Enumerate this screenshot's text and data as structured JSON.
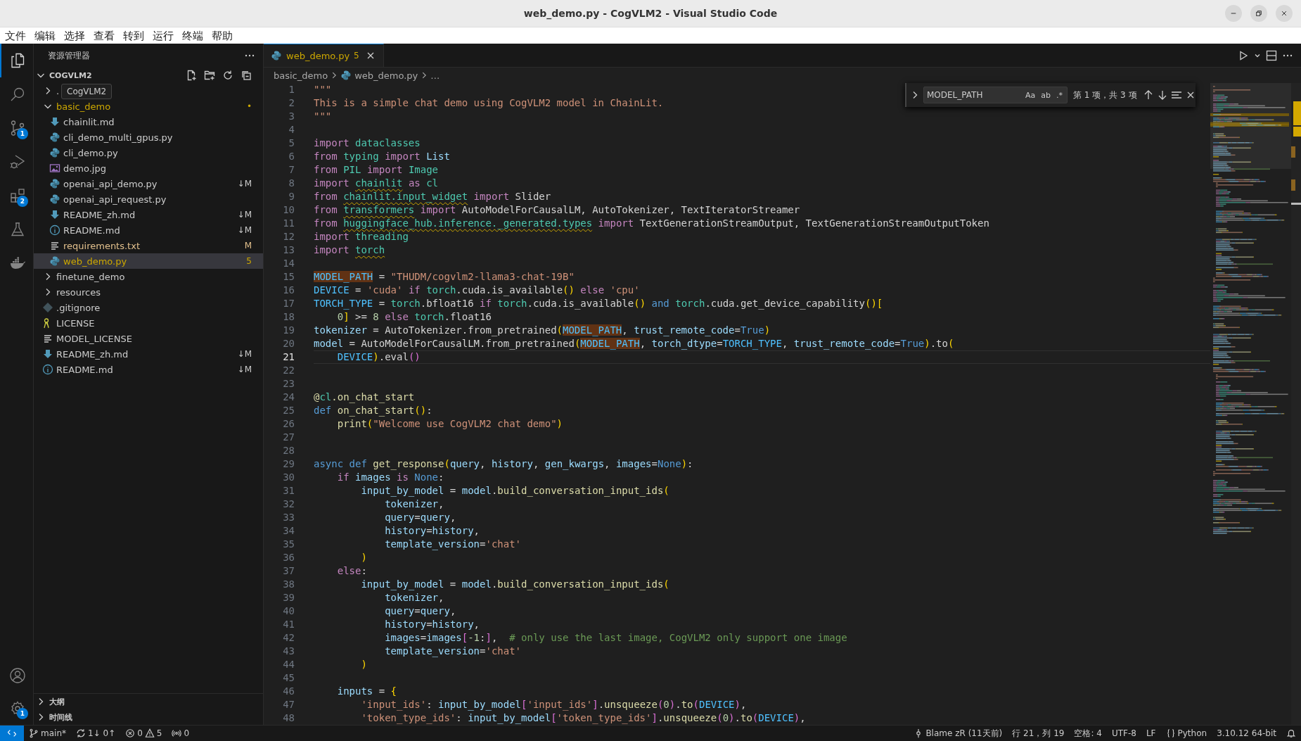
{
  "window": {
    "title": "web_demo.py - CogVLM2 - Visual Studio Code",
    "controls": [
      {
        "kind": "minimize"
      },
      {
        "kind": "maximize"
      },
      {
        "kind": "close"
      }
    ]
  },
  "menu": [
    "文件",
    "编辑",
    "选择",
    "查看",
    "转到",
    "运行",
    "终端",
    "帮助"
  ],
  "activity_bar": {
    "top": [
      {
        "kind": "explorer",
        "selected": true
      },
      {
        "kind": "search",
        "selected": false
      },
      {
        "kind": "source-control",
        "selected": false,
        "badge": "1"
      },
      {
        "kind": "run-debug",
        "selected": false
      },
      {
        "kind": "extensions",
        "selected": false,
        "badge": "2"
      },
      {
        "kind": "testing",
        "selected": false
      },
      {
        "kind": "docker",
        "selected": false
      }
    ],
    "bottom": [
      {
        "kind": "account",
        "selected": false
      },
      {
        "kind": "settings",
        "selected": false,
        "badge": "1"
      }
    ]
  },
  "explorer": {
    "title": "资源管理器",
    "tooltip": "CogVLM2",
    "root": {
      "label": "COGVLM2",
      "expanded": true,
      "children": [
        {
          "label": ".",
          "kind": "folder",
          "expanded": false,
          "selected": false
        },
        {
          "label": "basic_demo",
          "kind": "folder",
          "expanded": true,
          "selected": false,
          "color": "#cca700",
          "badge": "•",
          "children": [
            {
              "label": "chainlit.md",
              "kind": "markdown",
              "selected": false,
              "color": "#cccccc"
            },
            {
              "label": "cli_demo_multi_gpus.py",
              "kind": "python",
              "selected": false,
              "color": "#cccccc"
            },
            {
              "label": "cli_demo.py",
              "kind": "python",
              "selected": false,
              "color": "#cccccc"
            },
            {
              "label": "demo.jpg",
              "kind": "image",
              "selected": false,
              "color": "#cccccc"
            },
            {
              "label": "openai_api_demo.py",
              "kind": "python",
              "selected": false,
              "color": "#cccccc",
              "badge": "↓M"
            },
            {
              "label": "openai_api_request.py",
              "kind": "python",
              "selected": false,
              "color": "#cccccc"
            },
            {
              "label": "README_zh.md",
              "kind": "markdown",
              "selected": false,
              "color": "#cccccc",
              "badge": "↓M"
            },
            {
              "label": "README.md",
              "kind": "info",
              "selected": false,
              "color": "#cccccc",
              "badge": "↓M"
            },
            {
              "label": "requirements.txt",
              "kind": "text",
              "selected": false,
              "color": "#e2c08d",
              "badge": "M"
            },
            {
              "label": "web_demo.py",
              "kind": "python",
              "selected": true,
              "color": "#cca700",
              "badge": "5"
            }
          ]
        },
        {
          "label": "finetune_demo",
          "kind": "folder",
          "expanded": false,
          "selected": false,
          "color": "#cccccc"
        },
        {
          "label": "resources",
          "kind": "folder",
          "expanded": false,
          "selected": false,
          "color": "#cccccc"
        },
        {
          "label": ".gitignore",
          "kind": "git",
          "selected": false,
          "color": "#cccccc"
        },
        {
          "label": "LICENSE",
          "kind": "license",
          "selected": false,
          "color": "#cccccc"
        },
        {
          "label": "MODEL_LICENSE",
          "kind": "text",
          "selected": false,
          "color": "#cccccc"
        },
        {
          "label": "README_zh.md",
          "kind": "markdown",
          "selected": false,
          "color": "#cccccc",
          "badge": "↓M"
        },
        {
          "label": "README.md",
          "kind": "info",
          "selected": false,
          "color": "#cccccc",
          "badge": "↓M"
        }
      ]
    },
    "sections": [
      {
        "label": "大纲",
        "expanded": false
      },
      {
        "label": "时间线",
        "expanded": false
      }
    ]
  },
  "editor": {
    "tabs": [
      {
        "label": "web_demo.py",
        "kind": "python",
        "badge": "5",
        "selected": true
      }
    ],
    "actions": [
      {
        "kind": "run"
      },
      {
        "kind": "caret"
      },
      {
        "kind": "split"
      },
      {
        "kind": "more"
      }
    ],
    "breadcrumb": [
      {
        "label": "basic_demo",
        "kind": "folder"
      },
      {
        "label": "web_demo.py",
        "kind": "python"
      },
      {
        "label": "…",
        "kind": "plain"
      }
    ],
    "find": {
      "value": "MODEL_PATH",
      "options": [
        "Aa",
        "ab",
        ".*"
      ],
      "result": "第 1 项，共 3 项"
    },
    "lines": [
      {
        "n": "1",
        "current": false,
        "tokens": [
          {
            "text": "\"\"\"",
            "kind": "str"
          }
        ]
      },
      {
        "n": "2",
        "current": false,
        "tokens": [
          {
            "text": "This is a simple chat demo using CogVLM2 model in ChainLit.",
            "kind": "str"
          }
        ]
      },
      {
        "n": "3",
        "current": false,
        "tokens": [
          {
            "text": "\"\"\"",
            "kind": "str"
          }
        ]
      },
      {
        "n": "4",
        "current": false
      },
      {
        "n": "5",
        "current": false,
        "tokens": [
          {
            "text": "import ",
            "kind": "kw"
          },
          {
            "text": "dataclasses",
            "kind": "mod"
          }
        ]
      },
      {
        "n": "6",
        "current": false,
        "tokens": [
          {
            "text": "from ",
            "kind": "kw"
          },
          {
            "text": "typing ",
            "kind": "mod"
          },
          {
            "text": "import ",
            "kind": "kw"
          },
          {
            "text": "List",
            "kind": "var"
          }
        ]
      },
      {
        "n": "7",
        "current": false,
        "tokens": [
          {
            "text": "from ",
            "kind": "kw"
          },
          {
            "text": "PIL ",
            "kind": "mod"
          },
          {
            "text": "import ",
            "kind": "kw"
          },
          {
            "text": "Image",
            "kind": "mod"
          }
        ]
      },
      {
        "n": "8",
        "current": false,
        "tokens": [
          {
            "text": "import ",
            "kind": "kw"
          },
          {
            "text": "chainlit",
            "kind": "mod",
            "warn": true
          },
          {
            "text": " as ",
            "kind": "kw"
          },
          {
            "text": "cl",
            "kind": "mod"
          }
        ]
      },
      {
        "n": "9",
        "current": false,
        "tokens": [
          {
            "text": "from ",
            "kind": "kw"
          },
          {
            "text": "chainlit.input_widget",
            "kind": "mod",
            "warn": true
          },
          {
            "text": " import",
            "kind": "kw"
          },
          {
            "text": " Slider",
            "kind": "p"
          }
        ]
      },
      {
        "n": "10",
        "current": false,
        "tokens": [
          {
            "text": "from ",
            "kind": "kw"
          },
          {
            "text": "transformers",
            "kind": "mod",
            "warn": true
          },
          {
            "text": " import",
            "kind": "kw"
          },
          {
            "text": " AutoModelForCausalLM, AutoTokenizer, TextIteratorStreamer",
            "kind": "p"
          }
        ]
      },
      {
        "n": "11",
        "current": false,
        "tokens": [
          {
            "text": "from ",
            "kind": "kw"
          },
          {
            "text": "huggingface_hub.inference._generated.types",
            "kind": "mod",
            "warn": true
          },
          {
            "text": " import",
            "kind": "kw"
          },
          {
            "text": " TextGenerationStreamOutput, TextGenerationStreamOutputToken",
            "kind": "p"
          }
        ]
      },
      {
        "n": "12",
        "current": false,
        "tokens": [
          {
            "text": "import ",
            "kind": "kw"
          },
          {
            "text": "threading",
            "kind": "mod"
          }
        ]
      },
      {
        "n": "13",
        "current": false,
        "tokens": [
          {
            "text": "import ",
            "kind": "kw"
          },
          {
            "text": "torch",
            "kind": "mod",
            "warn": true
          }
        ]
      },
      {
        "n": "14",
        "current": false
      },
      {
        "n": "15",
        "current": false,
        "tokens": [
          {
            "text": "MODEL_PATH",
            "kind": "const",
            "match": true
          },
          {
            "text": " = ",
            "kind": "p"
          },
          {
            "text": "\"THUDM/cogvlm2-llama3-chat-19B\"",
            "kind": "str"
          }
        ]
      },
      {
        "n": "16",
        "current": false,
        "tokens": [
          {
            "text": "DEVICE",
            "kind": "const"
          },
          {
            "text": " = ",
            "kind": "p"
          },
          {
            "text": "'cuda' ",
            "kind": "str"
          },
          {
            "text": "if ",
            "kind": "kw"
          },
          {
            "text": "torch",
            "kind": "mod"
          },
          {
            "text": ".cuda.is_available",
            "kind": "p"
          },
          {
            "text": "()",
            "kind": "br"
          },
          {
            "text": " else ",
            "kind": "kw"
          },
          {
            "text": "'cpu'",
            "kind": "str"
          }
        ]
      },
      {
        "n": "17",
        "current": false,
        "tokens": [
          {
            "text": "TORCH_TYPE",
            "kind": "const"
          },
          {
            "text": " = ",
            "kind": "p"
          },
          {
            "text": "torch",
            "kind": "mod"
          },
          {
            "text": ".bfloat16 ",
            "kind": "p"
          },
          {
            "text": "if ",
            "kind": "kw"
          },
          {
            "text": "torch",
            "kind": "mod"
          },
          {
            "text": ".cuda.is_available",
            "kind": "p"
          },
          {
            "text": "()",
            "kind": "br"
          },
          {
            "text": " and ",
            "kind": "def"
          },
          {
            "text": "torch",
            "kind": "mod"
          },
          {
            "text": ".cuda.get_device_capability",
            "kind": "p"
          },
          {
            "text": "()[",
            "kind": "br"
          }
        ]
      },
      {
        "n": "18",
        "current": false,
        "tokens": [
          {
            "text": "    0",
            "kind": "num"
          },
          {
            "text": "]",
            "kind": "br"
          },
          {
            "text": " >= ",
            "kind": "p"
          },
          {
            "text": "8 ",
            "kind": "num"
          },
          {
            "text": "else ",
            "kind": "kw"
          },
          {
            "text": "torch",
            "kind": "mod"
          },
          {
            "text": ".float16",
            "kind": "p"
          }
        ]
      },
      {
        "n": "19",
        "current": false,
        "tokens": [
          {
            "text": "tokenizer",
            "kind": "var"
          },
          {
            "text": " = AutoTokenizer.from_pretrained",
            "kind": "p"
          },
          {
            "text": "(",
            "kind": "br"
          },
          {
            "text": "MODEL_PATH",
            "kind": "const",
            "match": true
          },
          {
            "text": ", ",
            "kind": "p"
          },
          {
            "text": "trust_remote_code",
            "kind": "var"
          },
          {
            "text": "=",
            "kind": "p"
          },
          {
            "text": "True",
            "kind": "def"
          },
          {
            "text": ")",
            "kind": "br"
          }
        ]
      },
      {
        "n": "20",
        "current": false,
        "tokens": [
          {
            "text": "model",
            "kind": "var"
          },
          {
            "text": " = AutoModelForCausalLM.from_pretrained",
            "kind": "p"
          },
          {
            "text": "(",
            "kind": "br"
          },
          {
            "text": "MODEL_PATH",
            "kind": "const",
            "match": true
          },
          {
            "text": ", ",
            "kind": "p"
          },
          {
            "text": "torch_dtype",
            "kind": "var"
          },
          {
            "text": "=",
            "kind": "p"
          },
          {
            "text": "TORCH_TYPE",
            "kind": "const"
          },
          {
            "text": ", ",
            "kind": "p"
          },
          {
            "text": "trust_remote_code",
            "kind": "var"
          },
          {
            "text": "=",
            "kind": "p"
          },
          {
            "text": "True",
            "kind": "def"
          },
          {
            "text": ")",
            "kind": "br"
          },
          {
            "text": ".to",
            "kind": "p"
          },
          {
            "text": "(",
            "kind": "br"
          }
        ]
      },
      {
        "n": "21",
        "current": true,
        "tokens": [
          {
            "text": "    DEVICE",
            "kind": "const"
          },
          {
            "text": ")",
            "kind": "br"
          },
          {
            "text": ".eval",
            "kind": "p"
          },
          {
            "text": "()",
            "kind": "br2"
          }
        ]
      },
      {
        "n": "22",
        "current": false
      },
      {
        "n": "23",
        "current": false
      },
      {
        "n": "24",
        "current": false,
        "tokens": [
          {
            "text": "@",
            "kind": "fn"
          },
          {
            "text": "cl",
            "kind": "mod"
          },
          {
            "text": ".on_chat_start",
            "kind": "fn"
          }
        ]
      },
      {
        "n": "25",
        "current": false,
        "tokens": [
          {
            "text": "def ",
            "kind": "def"
          },
          {
            "text": "on_chat_start",
            "kind": "fn"
          },
          {
            "text": "()",
            "kind": "br"
          },
          {
            "text": ":",
            "kind": "p"
          }
        ]
      },
      {
        "n": "26",
        "current": false,
        "tokens": [
          {
            "text": "    print",
            "kind": "fn"
          },
          {
            "text": "(",
            "kind": "br"
          },
          {
            "text": "\"Welcome use CogVLM2 chat demo\"",
            "kind": "str"
          },
          {
            "text": ")",
            "kind": "br"
          }
        ]
      },
      {
        "n": "27",
        "current": false
      },
      {
        "n": "28",
        "current": false
      },
      {
        "n": "29",
        "current": false,
        "tokens": [
          {
            "text": "async def ",
            "kind": "def"
          },
          {
            "text": "get_response",
            "kind": "fn"
          },
          {
            "text": "(",
            "kind": "br"
          },
          {
            "text": "query",
            "kind": "var"
          },
          {
            "text": ", ",
            "kind": "p"
          },
          {
            "text": "history",
            "kind": "var"
          },
          {
            "text": ", ",
            "kind": "p"
          },
          {
            "text": "gen_kwargs",
            "kind": "var"
          },
          {
            "text": ", ",
            "kind": "p"
          },
          {
            "text": "images",
            "kind": "var"
          },
          {
            "text": "=",
            "kind": "p"
          },
          {
            "text": "None",
            "kind": "def"
          },
          {
            "text": ")",
            "kind": "br"
          },
          {
            "text": ":",
            "kind": "p"
          }
        ]
      },
      {
        "n": "30",
        "current": false,
        "tokens": [
          {
            "text": "    if ",
            "kind": "kw"
          },
          {
            "text": "images ",
            "kind": "var"
          },
          {
            "text": "is ",
            "kind": "kw"
          },
          {
            "text": "None",
            "kind": "def"
          },
          {
            "text": ":",
            "kind": "p"
          }
        ]
      },
      {
        "n": "31",
        "current": false,
        "tokens": [
          {
            "text": "        input_by_model",
            "kind": "var"
          },
          {
            "text": " = ",
            "kind": "p"
          },
          {
            "text": "model",
            "kind": "var"
          },
          {
            "text": ".",
            "kind": "p"
          },
          {
            "text": "build_conversation_input_ids",
            "kind": "fn"
          },
          {
            "text": "(",
            "kind": "br"
          }
        ]
      },
      {
        "n": "32",
        "current": false,
        "tokens": [
          {
            "text": "            tokenizer",
            "kind": "var"
          },
          {
            "text": ",",
            "kind": "p"
          }
        ]
      },
      {
        "n": "33",
        "current": false,
        "tokens": [
          {
            "text": "            query",
            "kind": "var"
          },
          {
            "text": "=",
            "kind": "p"
          },
          {
            "text": "query",
            "kind": "var"
          },
          {
            "text": ",",
            "kind": "p"
          }
        ]
      },
      {
        "n": "34",
        "current": false,
        "tokens": [
          {
            "text": "            history",
            "kind": "var"
          },
          {
            "text": "=",
            "kind": "p"
          },
          {
            "text": "history",
            "kind": "var"
          },
          {
            "text": ",",
            "kind": "p"
          }
        ]
      },
      {
        "n": "35",
        "current": false,
        "tokens": [
          {
            "text": "            template_version",
            "kind": "var"
          },
          {
            "text": "=",
            "kind": "p"
          },
          {
            "text": "'chat'",
            "kind": "str"
          }
        ]
      },
      {
        "n": "36",
        "current": false,
        "tokens": [
          {
            "text": "        )",
            "kind": "br"
          }
        ]
      },
      {
        "n": "37",
        "current": false,
        "tokens": [
          {
            "text": "    else",
            "kind": "kw"
          },
          {
            "text": ":",
            "kind": "p"
          }
        ]
      },
      {
        "n": "38",
        "current": false,
        "tokens": [
          {
            "text": "        input_by_model",
            "kind": "var"
          },
          {
            "text": " = ",
            "kind": "p"
          },
          {
            "text": "model",
            "kind": "var"
          },
          {
            "text": ".",
            "kind": "p"
          },
          {
            "text": "build_conversation_input_ids",
            "kind": "fn"
          },
          {
            "text": "(",
            "kind": "br"
          }
        ]
      },
      {
        "n": "39",
        "current": false,
        "tokens": [
          {
            "text": "            tokenizer",
            "kind": "var"
          },
          {
            "text": ",",
            "kind": "p"
          }
        ]
      },
      {
        "n": "40",
        "current": false,
        "tokens": [
          {
            "text": "            query",
            "kind": "var"
          },
          {
            "text": "=",
            "kind": "p"
          },
          {
            "text": "query",
            "kind": "var"
          },
          {
            "text": ",",
            "kind": "p"
          }
        ]
      },
      {
        "n": "41",
        "current": false,
        "tokens": [
          {
            "text": "            history",
            "kind": "var"
          },
          {
            "text": "=",
            "kind": "p"
          },
          {
            "text": "history",
            "kind": "var"
          },
          {
            "text": ",",
            "kind": "p"
          }
        ]
      },
      {
        "n": "42",
        "current": false,
        "tokens": [
          {
            "text": "            images",
            "kind": "var"
          },
          {
            "text": "=",
            "kind": "p"
          },
          {
            "text": "images",
            "kind": "var"
          },
          {
            "text": "[",
            "kind": "br2"
          },
          {
            "text": "-1",
            "kind": "num"
          },
          {
            "text": ":",
            "kind": "p"
          },
          {
            "text": "]",
            "kind": "br2"
          },
          {
            "text": ",  ",
            "kind": "p"
          },
          {
            "text": "# only use the last image, CogVLM2 only support one image",
            "kind": "cmt"
          }
        ]
      },
      {
        "n": "43",
        "current": false,
        "tokens": [
          {
            "text": "            template_version",
            "kind": "var"
          },
          {
            "text": "=",
            "kind": "p"
          },
          {
            "text": "'chat'",
            "kind": "str"
          }
        ]
      },
      {
        "n": "44",
        "current": false,
        "tokens": [
          {
            "text": "        )",
            "kind": "br"
          }
        ]
      },
      {
        "n": "45",
        "current": false
      },
      {
        "n": "46",
        "current": false,
        "tokens": [
          {
            "text": "    inputs",
            "kind": "var"
          },
          {
            "text": " = ",
            "kind": "p"
          },
          {
            "text": "{",
            "kind": "br"
          }
        ]
      },
      {
        "n": "47",
        "current": false,
        "tokens": [
          {
            "text": "        'input_ids'",
            "kind": "str"
          },
          {
            "text": ": ",
            "kind": "p"
          },
          {
            "text": "input_by_model",
            "kind": "var"
          },
          {
            "text": "[",
            "kind": "br2"
          },
          {
            "text": "'input_ids'",
            "kind": "str"
          },
          {
            "text": "]",
            "kind": "br2"
          },
          {
            "text": ".",
            "kind": "p"
          },
          {
            "text": "unsqueeze",
            "kind": "fn"
          },
          {
            "text": "(",
            "kind": "br2"
          },
          {
            "text": "0",
            "kind": "num"
          },
          {
            "text": ")",
            "kind": "br2"
          },
          {
            "text": ".",
            "kind": "p"
          },
          {
            "text": "to",
            "kind": "fn"
          },
          {
            "text": "(",
            "kind": "br2"
          },
          {
            "text": "DEVICE",
            "kind": "const"
          },
          {
            "text": ")",
            "kind": "br2"
          },
          {
            "text": ",",
            "kind": "p"
          }
        ]
      },
      {
        "n": "48",
        "current": false,
        "tokens": [
          {
            "text": "        'token_type_ids'",
            "kind": "str"
          },
          {
            "text": ": ",
            "kind": "p"
          },
          {
            "text": "input_by_model",
            "kind": "var"
          },
          {
            "text": "[",
            "kind": "br2"
          },
          {
            "text": "'token_type_ids'",
            "kind": "str"
          },
          {
            "text": "]",
            "kind": "br2"
          },
          {
            "text": ".",
            "kind": "p"
          },
          {
            "text": "unsqueeze",
            "kind": "fn"
          },
          {
            "text": "(",
            "kind": "br2"
          },
          {
            "text": "0",
            "kind": "num"
          },
          {
            "text": ")",
            "kind": "br2"
          },
          {
            "text": ".",
            "kind": "p"
          },
          {
            "text": "to",
            "kind": "fn"
          },
          {
            "text": "(",
            "kind": "br2"
          },
          {
            "text": "DEVICE",
            "kind": "const"
          },
          {
            "text": ")",
            "kind": "br2"
          },
          {
            "text": ",",
            "kind": "p"
          }
        ]
      }
    ]
  },
  "status_bar": {
    "left": [
      {
        "kind": "remote"
      },
      {
        "kind": "branch",
        "text": "main*"
      },
      {
        "kind": "sync",
        "text": "1↓ 0↑"
      },
      {
        "kind": "problems",
        "errors": "0",
        "warnings": "5"
      },
      {
        "kind": "ports",
        "text": "0"
      }
    ],
    "right": [
      {
        "kind": "blame",
        "text": "Blame zR (11天前)"
      },
      {
        "kind": "plain",
        "text": "行 21，列 19"
      },
      {
        "kind": "plain",
        "text": "空格: 4"
      },
      {
        "kind": "plain",
        "text": "UTF-8"
      },
      {
        "kind": "plain",
        "text": "LF"
      },
      {
        "kind": "language",
        "text": "Python"
      },
      {
        "kind": "plain",
        "text": "3.10.12 64-bit"
      },
      {
        "kind": "bell"
      }
    ]
  }
}
